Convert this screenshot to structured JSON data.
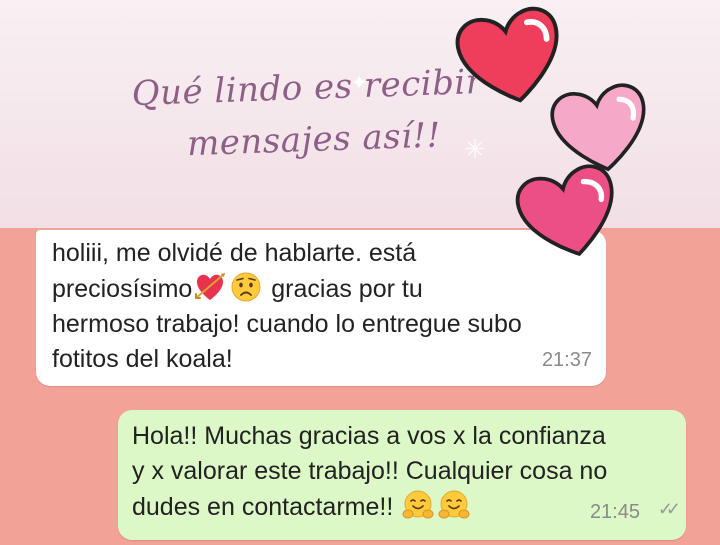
{
  "banner": {
    "title_line1": "Qué lindo es recibir",
    "title_line2": "mensajes así!!"
  },
  "colors": {
    "chat_background": "#f3a298",
    "incoming_bubble": "#ffffff",
    "outgoing_bubble": "#dcf8c6",
    "heart_red": "#ee3e5b",
    "heart_light_pink": "#f6a8c8",
    "heart_pink": "#ec4f86"
  },
  "messages": [
    {
      "direction": "incoming",
      "text_1": "holiii, me olvidé de hablarte. está",
      "text_2": "preciosísimo",
      "emoji_1": "heart-with-arrow-icon",
      "emoji_2": "worried-face-icon",
      "text_3": " gracias por tu",
      "text_4": "hermoso trabajo! cuando lo entregue subo",
      "text_5": "fotitos del koala!",
      "time": "21:37"
    },
    {
      "direction": "outgoing",
      "text_1": "Hola!! Muchas gracias a vos x la confianza",
      "text_2": "y x valorar este trabajo!! Cualquier cosa no",
      "text_3": "dudes en contactarme!!",
      "emoji_1": "hugging-face-icon",
      "emoji_2": "hugging-face-icon",
      "time": "21:45",
      "status": "read-double-check-icon"
    }
  ]
}
